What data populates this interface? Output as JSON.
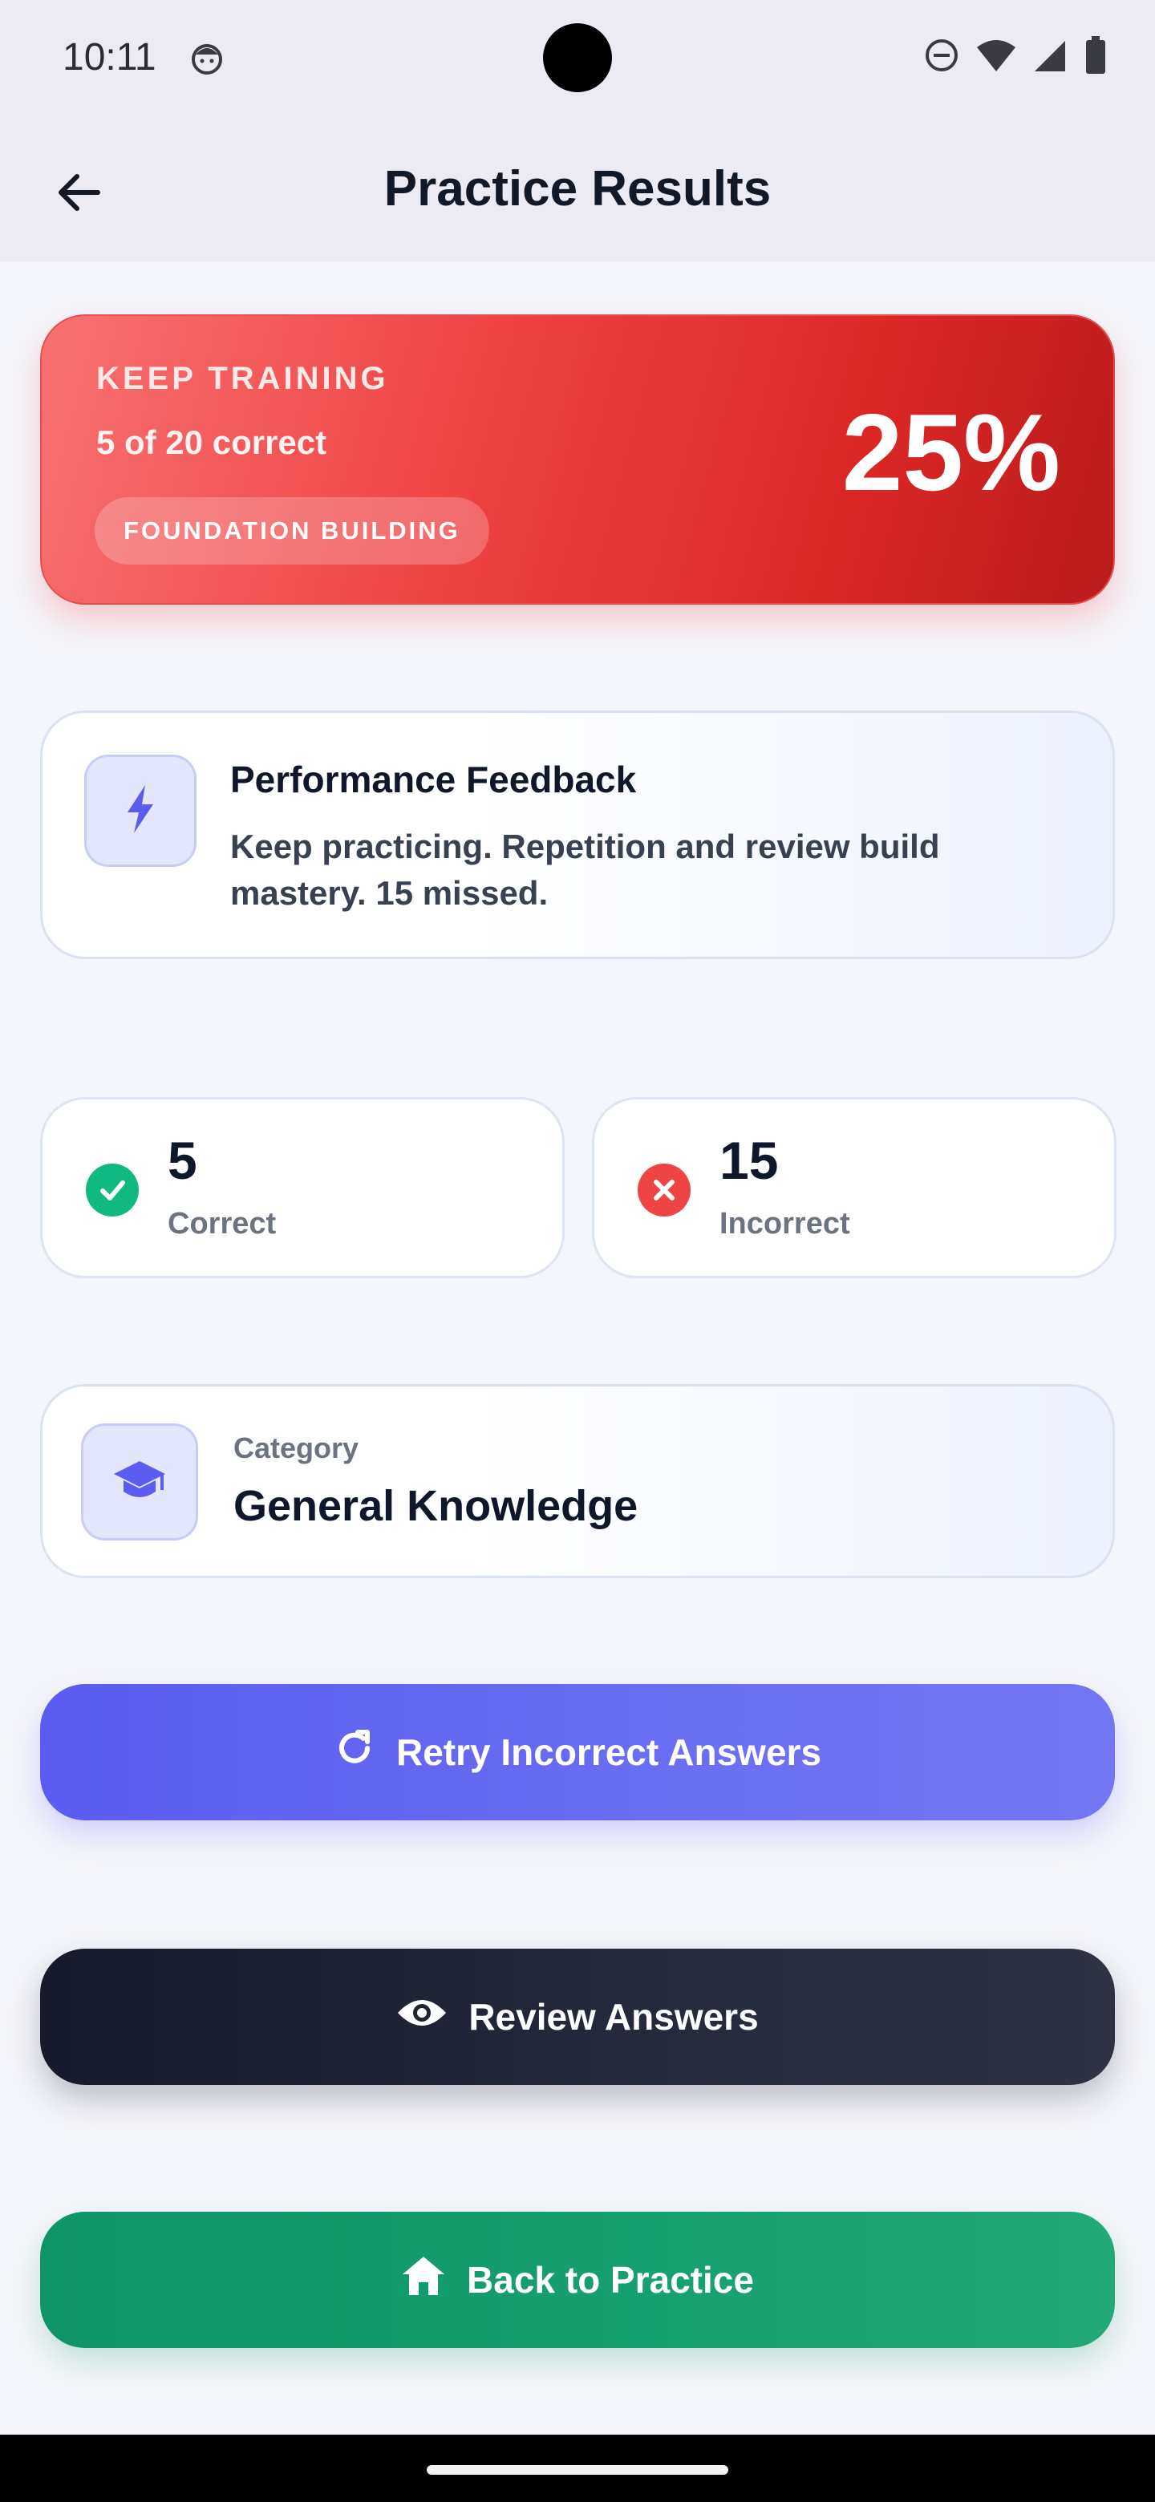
{
  "status_bar": {
    "time": "10:11"
  },
  "app_bar": {
    "title": "Practice Results"
  },
  "hero": {
    "eyebrow": "KEEP TRAINING",
    "summary": "5 of 20 correct",
    "badge": "FOUNDATION BUILDING",
    "percent": "25%",
    "color": "#ef4444"
  },
  "feedback": {
    "title": "Performance Feedback",
    "text": "Keep practicing. Repetition and review build mastery. 15 missed.",
    "icon": "lightning-icon"
  },
  "stats": {
    "correct": {
      "value": "5",
      "label": "Correct",
      "icon": "check-circle-icon",
      "color": "#10b981"
    },
    "incorrect": {
      "value": "15",
      "label": "Incorrect",
      "icon": "x-circle-icon",
      "color": "#ef4444"
    }
  },
  "category": {
    "label": "Category",
    "value": "General Knowledge",
    "icon": "graduation-cap-icon"
  },
  "buttons": {
    "retry": {
      "label": "Retry Incorrect Answers",
      "icon": "refresh-icon",
      "color": "#6366f1"
    },
    "review": {
      "label": "Review Answers",
      "icon": "eye-icon",
      "color": "#1f2433"
    },
    "home": {
      "label": "Back to Practice",
      "icon": "home-icon",
      "color": "#16a06f"
    }
  }
}
